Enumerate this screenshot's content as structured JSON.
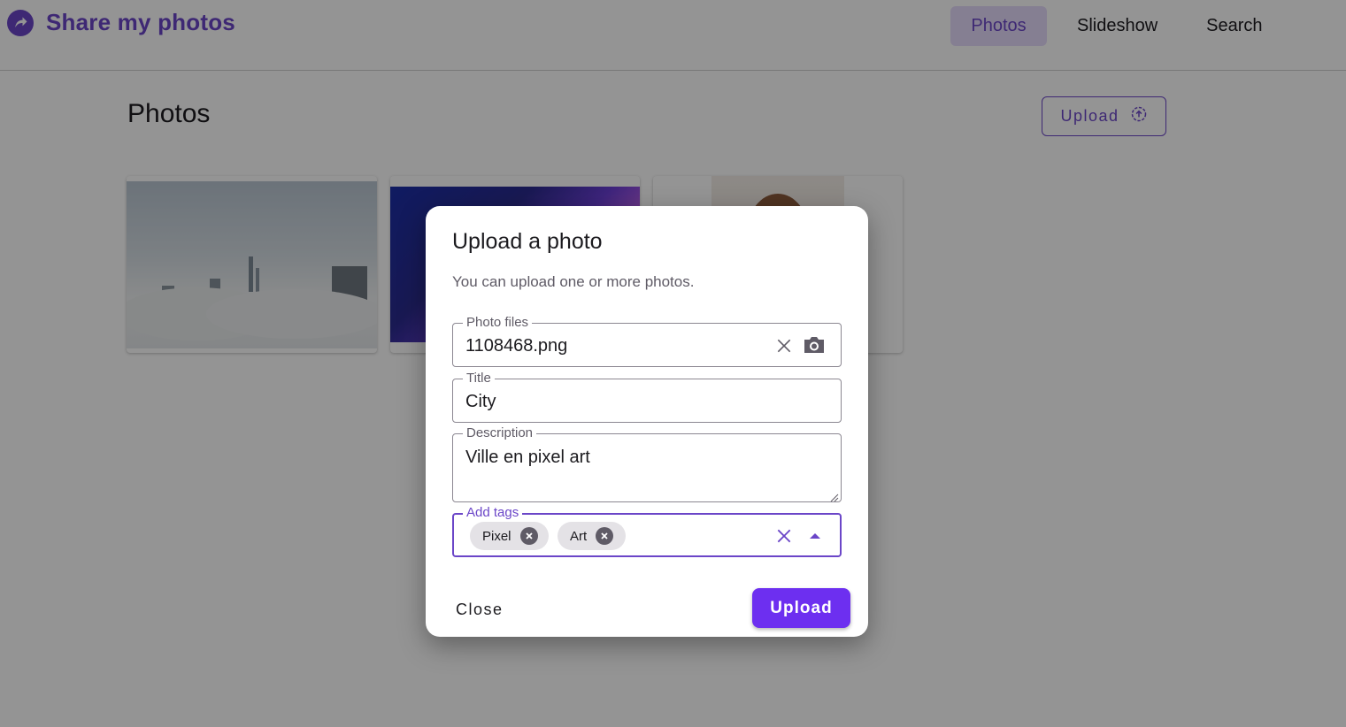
{
  "app": {
    "title": "Share my photos",
    "nav": [
      "Photos",
      "Slideshow",
      "Search"
    ],
    "active_nav": "Photos"
  },
  "page": {
    "title": "Photos",
    "upload_label": "Upload"
  },
  "photos": [
    {
      "subject": "foggy city skyline"
    },
    {
      "subject": "pixel art cityscape"
    },
    {
      "subject": "portrait"
    }
  ],
  "dialog": {
    "title": "Upload a photo",
    "subtitle": "You can upload one or more photos.",
    "files": {
      "label": "Photo files",
      "value": "1108468.png"
    },
    "title_field": {
      "label": "Title",
      "value": "City"
    },
    "description": {
      "label": "Description",
      "value": "Ville en pixel art"
    },
    "tags": {
      "label": "Add tags",
      "chips": [
        "Pixel",
        "Art"
      ]
    },
    "close_label": "Close",
    "upload_label": "Upload"
  },
  "colors": {
    "accent": "#6b46c8",
    "primary_button": "#6d2ff0",
    "nav_active_bg": "#e6dbfb"
  },
  "icons": [
    "share-arrow-icon",
    "upload-circle-icon",
    "clear-icon",
    "camera-icon",
    "chip-remove-icon",
    "dropdown-arrow-icon"
  ]
}
